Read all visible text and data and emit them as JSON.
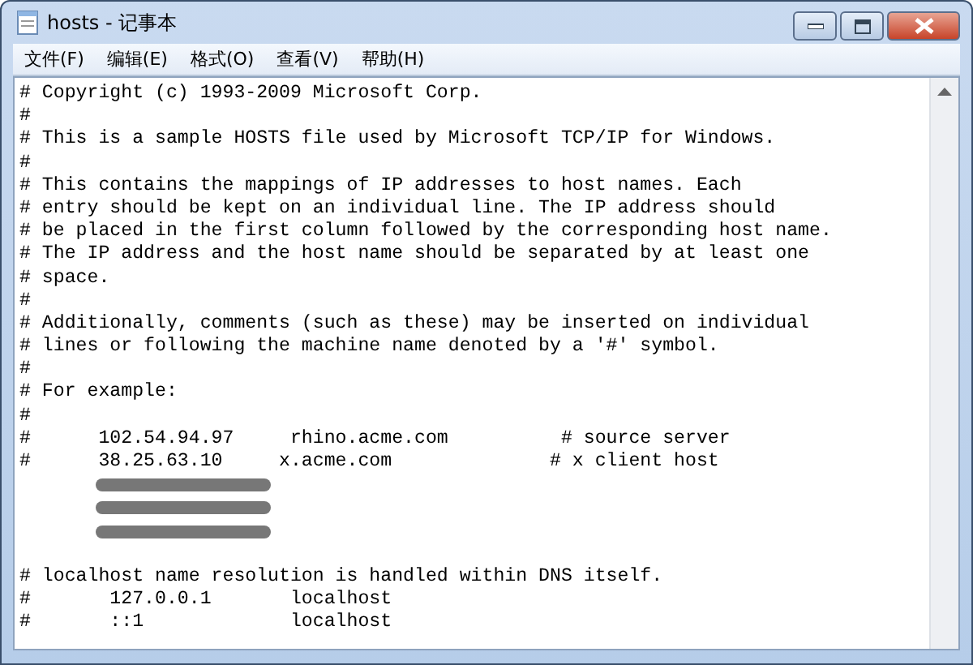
{
  "window": {
    "title": "hosts - 记事本"
  },
  "menu": [
    "文件(F)",
    "编辑(E)",
    "格式(O)",
    "查看(V)",
    "帮助(H)"
  ],
  "lines": [
    {
      "kind": "text",
      "text": "# Copyright (c) 1993-2009 Microsoft Corp."
    },
    {
      "kind": "text",
      "text": "#"
    },
    {
      "kind": "text",
      "text": "# This is a sample HOSTS file used by Microsoft TCP/IP for Windows."
    },
    {
      "kind": "text",
      "text": "#"
    },
    {
      "kind": "text",
      "text": "# This contains the mappings of IP addresses to host names. Each"
    },
    {
      "kind": "text",
      "text": "# entry should be kept on an individual line. The IP address should"
    },
    {
      "kind": "text",
      "text": "# be placed in the first column followed by the corresponding host name."
    },
    {
      "kind": "text",
      "text": "# The IP address and the host name should be separated by at least one"
    },
    {
      "kind": "text",
      "text": "# space."
    },
    {
      "kind": "text",
      "text": "#"
    },
    {
      "kind": "text",
      "text": "# Additionally, comments (such as these) may be inserted on individual"
    },
    {
      "kind": "text",
      "text": "# lines or following the machine name denoted by a '#' symbol."
    },
    {
      "kind": "text",
      "text": "#"
    },
    {
      "kind": "text",
      "text": "# For example:"
    },
    {
      "kind": "text",
      "text": "#"
    },
    {
      "kind": "text",
      "text": "#      102.54.94.97     rhino.acme.com          # source server"
    },
    {
      "kind": "text",
      "text": "#      38.25.63.10     x.acme.com              # x client host"
    },
    {
      "kind": "redacted"
    },
    {
      "kind": "redacted"
    },
    {
      "kind": "redacted"
    },
    {
      "kind": "blank"
    },
    {
      "kind": "text",
      "text": "# localhost name resolution is handled within DNS itself."
    },
    {
      "kind": "text",
      "text": "#       127.0.0.1       localhost"
    },
    {
      "kind": "text",
      "text": "#       ::1             localhost"
    }
  ]
}
